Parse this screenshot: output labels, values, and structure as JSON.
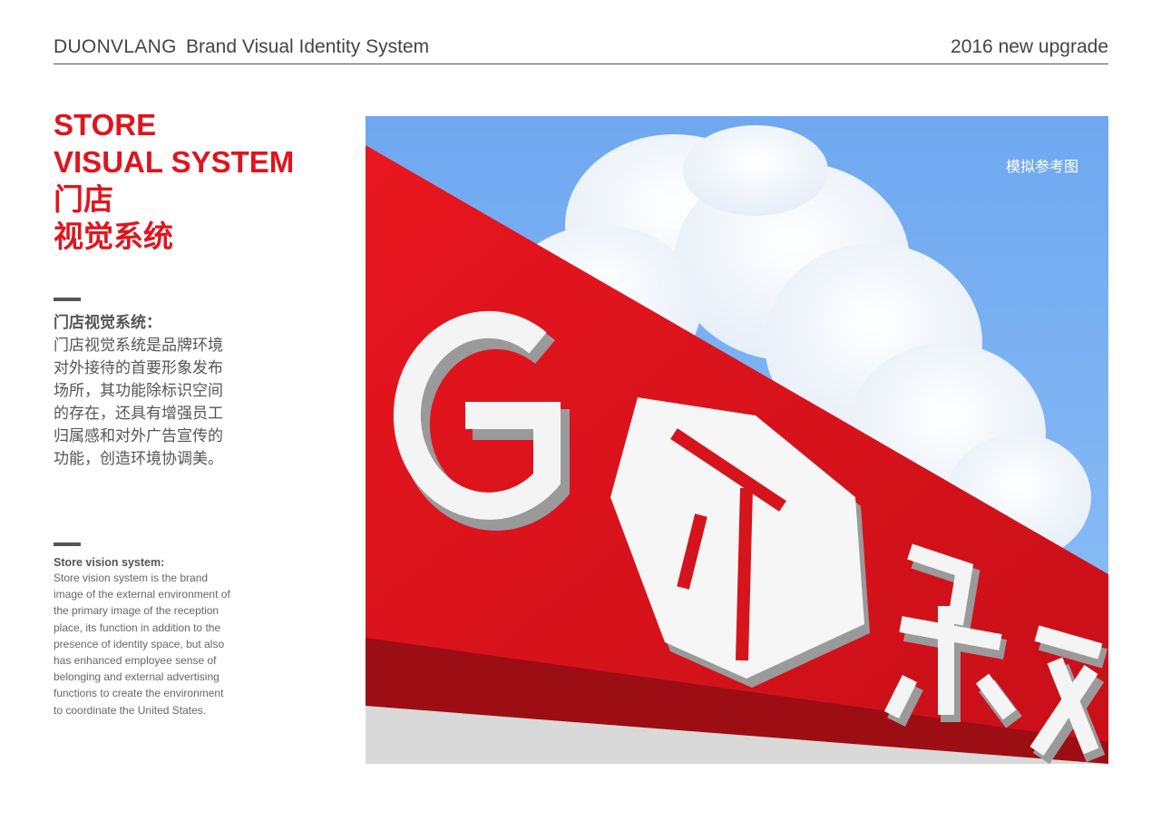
{
  "header": {
    "brand": "DUONVLANG",
    "subtitle": "Brand Visual Identity System",
    "year": "2016 new upgrade"
  },
  "title": {
    "line1": "STORE",
    "line2": "VISUAL SYSTEM",
    "line3": "门店",
    "line4": "视觉系统"
  },
  "cn_section": {
    "heading": "门店视觉系统：",
    "body": "门店视觉系统是品牌环境对外接待的首要形象发布场所，其功能除标识空间的存在，还具有增强员工归属感和对外广告宣传的功能，创造环境协调美。"
  },
  "en_section": {
    "heading": "Store vision system:",
    "body": "Store vision system is the brand image of the external environment of the primary image of the reception place, its function in addition to the presence of identity space, but also has enhanced employee sense of belonging and external advertising functions to create the environment to coordinate the United States."
  },
  "photo": {
    "caption": "模拟参考图",
    "sign_text": "G 朵艾",
    "colors": {
      "sky": "#7ab2f4",
      "sign_red": "#e0141e",
      "letters": "#f4f4f4"
    }
  }
}
